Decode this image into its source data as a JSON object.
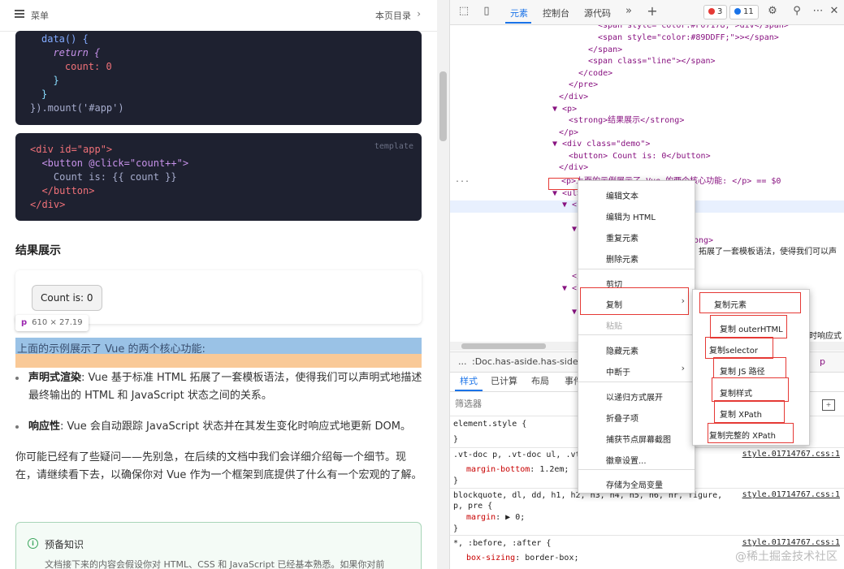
{
  "doc": {
    "menu_label": "菜单",
    "toc_label": "本页目录",
    "code1_lines": [
      "data() {",
      "  return {",
      "    count: 0",
      "  }",
      "}",
      "}).mount('#app')"
    ],
    "code2_lang": "template",
    "code2_lines": [
      "<div id=\"app\">",
      "  <button @click=\"count++\">",
      "    Count is: {{ count }}",
      "  </button>",
      "</div>"
    ],
    "result_heading": "结果展示",
    "count_button": "Count is: 0",
    "inspect_tag": "p",
    "inspect_dims": "610 × 27.19",
    "highlight_text": "上面的示例展示了 Vue 的两个核心功能:",
    "bullet1_bold": "声明式渲染",
    "bullet1_text": ": Vue 基于标准 HTML 拓展了一套模板语法，使得我们可以声明式地描述最终输出的 HTML 和 JavaScript 状态之间的关系。",
    "bullet2_bold": "响应性",
    "bullet2_text": ": Vue 会自动跟踪 JavaScript 状态并在其发生变化时响应式地更新 DOM。",
    "para_text": "你可能已经有了些疑问——先别急，在后续的文档中我们会详细介绍每一个细节。现在，请继续看下去，以确保你对 Vue 作为一个框架到底提供了什么有一个宏观的了解。",
    "tip_title": "预备知识",
    "tip_body": "文档接下来的内容会假设你对 HTML、CSS 和 JavaScript 已经基本熟悉。如果你对前"
  },
  "devtools": {
    "tabs": [
      "元素",
      "控制台",
      "源代码"
    ],
    "error_count": "3",
    "message_count": "11",
    "error_color": "#e53935",
    "message_color": "#1a73e8",
    "tree_lines": [
      "<span style=\"color:#F07178;\">div</span>",
      "<span style=\"color:#89DDFF;\">></span>",
      "</span>",
      "<span class=\"line\"></span>",
      "</code>",
      "</pre>",
      "</div>",
      "▼ <p>",
      "<strong>结果展示</strong>",
      "</p>",
      "▼ <div class=\"demo\">",
      "<button> Count is: 0</button>",
      "</div>",
      "<p>上面的示例展示了 Vue 的两个核心功能: </p> == $0",
      "▼ <ul>",
      "▼ <li>",
      "▼",
      "ong>",
      "拓展了一套模板语法，使得我们可以声",
      "</",
      "▼ <l",
      "▼",
      "时响应式"
    ],
    "selected_suffix": "== $0",
    "crumb_dots": "...",
    "crumb_path": ":Doc.has-aside.has-sidebar",
    "crumb_p": "p",
    "style_tabs": [
      "样式",
      "已计算",
      "布局",
      "事件"
    ],
    "filter_placeholder": "筛选器",
    "css_rules": [
      {
        "selector": "element.style {",
        "props": [],
        "close": "}",
        "link": ""
      },
      {
        "selector": ".vt-doc p, .vt-doc ul, .vt",
        "props": [
          {
            "name": "margin-bottom",
            "value": "1.2em;"
          }
        ],
        "close": "}",
        "link": "style.01714767.css:1"
      },
      {
        "selector": "blockquote, dl, dd, h1, h2, h3, h4, h5, h6, hr, figure,",
        "selector2": "p, pre {",
        "props": [
          {
            "name": "margin",
            "value": "▶ 0;"
          }
        ],
        "close": "}",
        "link": "style.01714767.css:1"
      },
      {
        "selector": "*, :before, :after {",
        "props": [
          {
            "name": "box-sizing",
            "value": "border-box;"
          }
        ],
        "close": "",
        "link": "style.01714767.css:1"
      }
    ]
  },
  "context_menu": {
    "items": [
      "编辑文本",
      "编辑为 HTML",
      "重复元素",
      "删除元素",
      "剪切",
      "复制",
      "粘贴",
      "隐藏元素",
      "中断于",
      "以递归方式展开",
      "折叠子项",
      "捕获节点屏幕截图",
      "徽章设置...",
      "存储为全局变量"
    ],
    "submenu": [
      "复制元素",
      "复制 outerHTML",
      "复制selector",
      "复制 JS 路径",
      "复制样式",
      "复制 XPath",
      "复制完整的 XPath"
    ]
  },
  "watermark": "@稀土掘金技术社区",
  "highlight_colors": {
    "annotation_red": "#e53935",
    "content_blue": "#6fa8dc",
    "margin_orange": "#f6b26b"
  }
}
